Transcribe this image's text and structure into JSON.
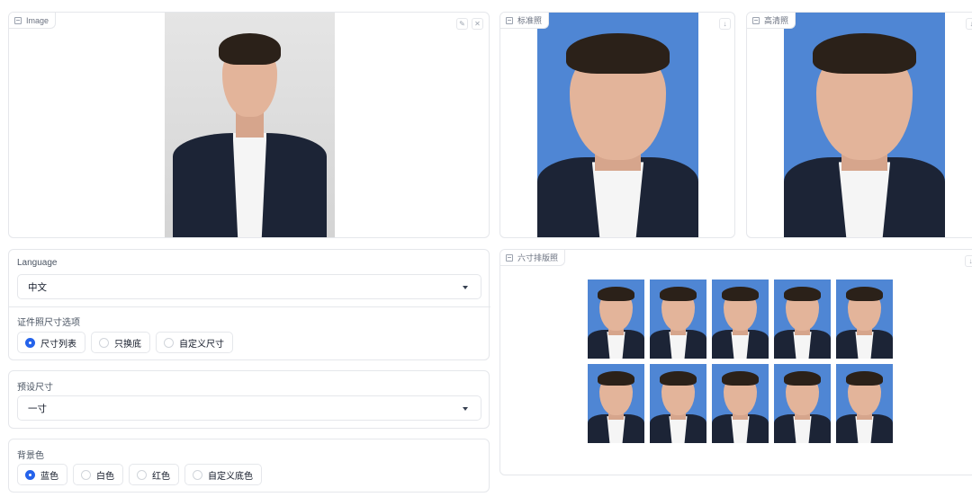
{
  "input_panel": {
    "label": "Image"
  },
  "output_panels": {
    "standard": {
      "label": "标准照"
    },
    "hd": {
      "label": "高清照"
    },
    "layout": {
      "label": "六寸排版照",
      "copies": 10
    }
  },
  "language": {
    "label": "Language",
    "value": "中文"
  },
  "size_option": {
    "label": "证件照尺寸选项",
    "options": [
      "尺寸列表",
      "只换底",
      "自定义尺寸"
    ],
    "selected": "尺寸列表"
  },
  "preset_size": {
    "label": "预设尺寸",
    "value": "一寸"
  },
  "background_color": {
    "label": "背景色",
    "options": [
      "蓝色",
      "白色",
      "红色",
      "自定义底色"
    ],
    "selected": "蓝色"
  },
  "colors": {
    "accent": "#2563eb",
    "photo_blue": "#4f86d4"
  },
  "icons": {
    "image": "image-icon",
    "edit": "pencil-icon",
    "clear": "close-icon",
    "download": "download-icon"
  }
}
